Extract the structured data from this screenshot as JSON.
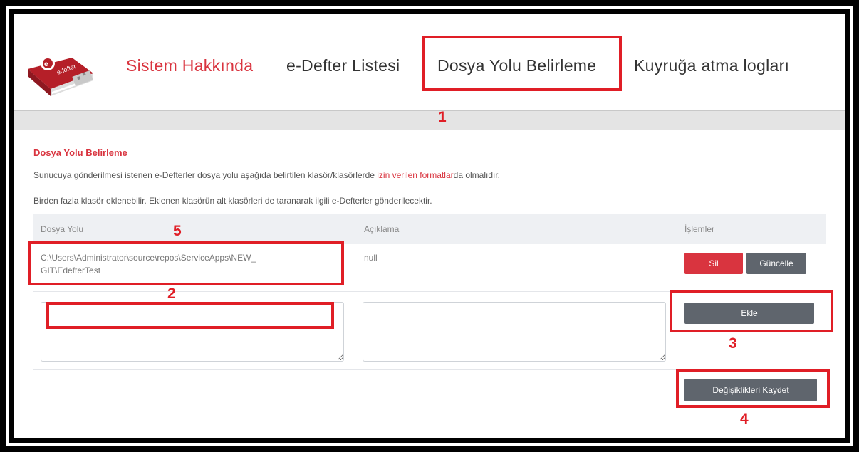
{
  "nav": {
    "items": [
      {
        "label": "Sistem Hakkında",
        "active": true
      },
      {
        "label": "e-Defter Listesi",
        "active": false
      },
      {
        "label": "Dosya Yolu Belirleme",
        "active": false
      },
      {
        "label": "Kuyruğa atma logları",
        "active": false
      }
    ],
    "logo_text": "edefter"
  },
  "section": {
    "title": "Dosya Yolu Belirleme",
    "para1_before": "Sunucuya gönderilmesi istenen e-Defterler dosya yolu aşağıda belirtilen klasör/klasörlerde ",
    "para1_link": "izin verilen formatlar",
    "para1_after": "da olmalıdır.",
    "para2": "Birden fazla klasör eklenebilir. Eklenen klasörün alt klasörleri de taranarak ilgili e-Defterler gönderilecektir."
  },
  "table": {
    "headers": [
      "Dosya Yolu",
      "Açıklama",
      "İşlemler"
    ],
    "rows": [
      {
        "path_line1": "C:\\Users\\Administrator\\source\\repos\\ServiceApps\\NEW_",
        "path_line2": "GIT\\EdefterTest",
        "description": "null"
      }
    ]
  },
  "buttons": {
    "delete": "Sil",
    "update": "Güncelle",
    "add": "Ekle",
    "save": "Değişiklikleri Kaydet"
  },
  "annotations": [
    "1",
    "2",
    "3",
    "4",
    "5"
  ],
  "colors": {
    "accent": "#d9343f",
    "annotation": "#e01e26",
    "button_gray": "#5f656d"
  }
}
